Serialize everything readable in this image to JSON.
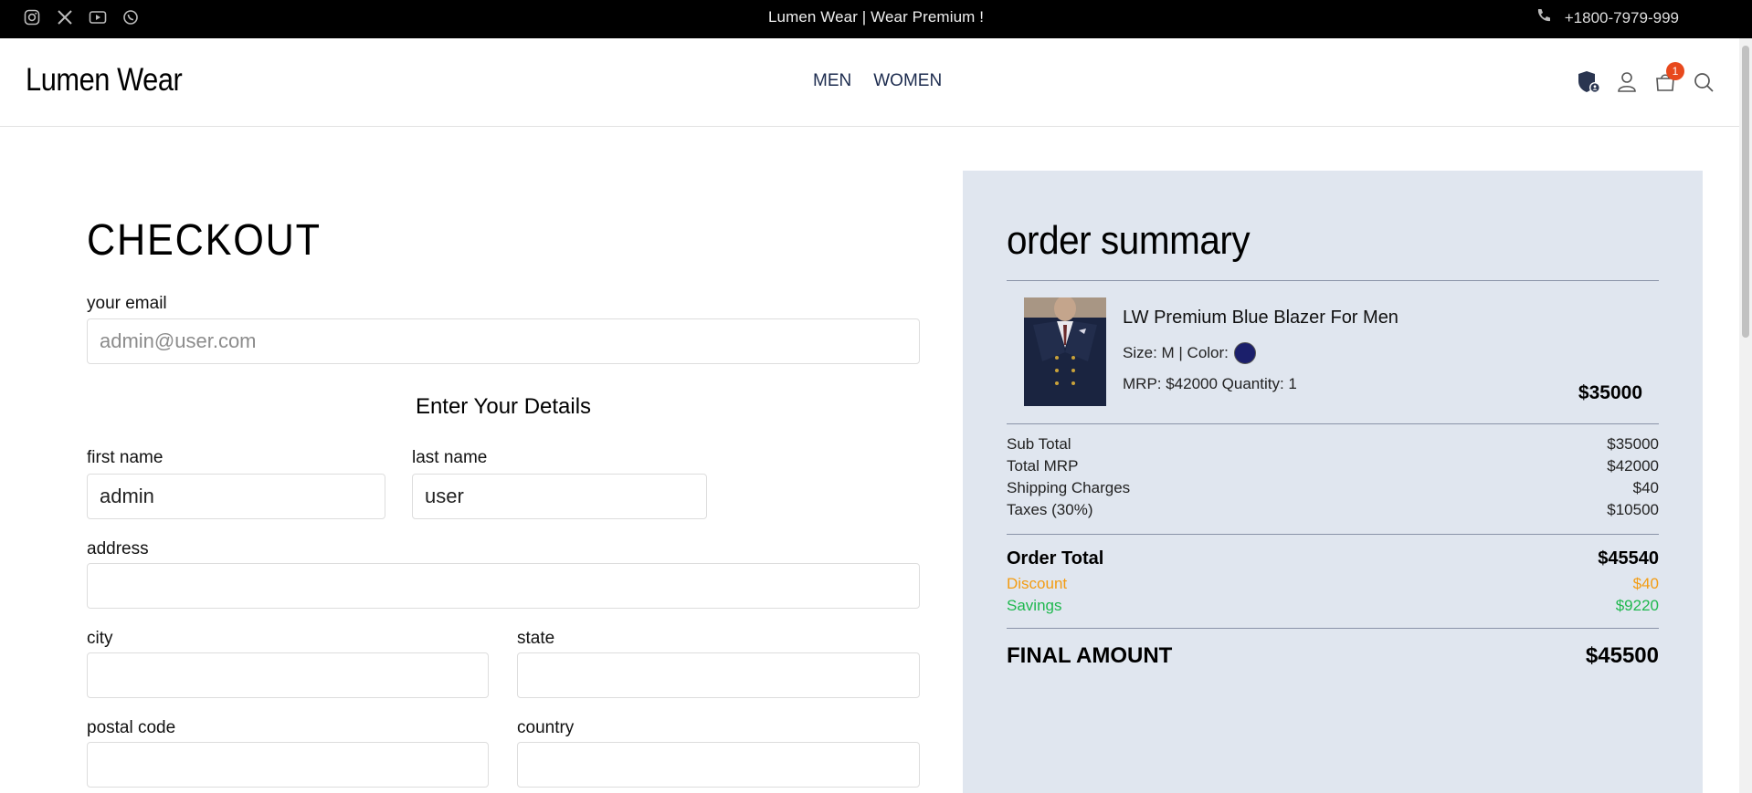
{
  "topbar": {
    "social_icons": [
      "instagram-icon",
      "x-icon",
      "youtube-icon",
      "whatsapp-icon"
    ],
    "promo": "Lumen Wear  |   Wear Premium !",
    "phone": "+1800-7979-999"
  },
  "header": {
    "brand": "Lumen Wear",
    "nav": [
      "MEN",
      "WOMEN"
    ],
    "cart_count": "1"
  },
  "checkout": {
    "title": "CHECKOUT",
    "email_label": "your email",
    "email_placeholder": "admin@user.com",
    "details_heading": "Enter Your Details",
    "first_name_label": "first name",
    "first_name_value": "admin",
    "last_name_label": "last name",
    "last_name_value": "user",
    "address_label": "address",
    "city_label": "city",
    "state_label": "state",
    "postal_label": "postal code",
    "country_label": "country"
  },
  "summary": {
    "title": "order summary",
    "product": {
      "name": "LW Premium Blue Blazer For Men",
      "size_color": "Size: M | Color:",
      "color_hex": "#1b1f6b",
      "mrp_qty": "MRP: $42000  Quantity: 1",
      "price": "$35000"
    },
    "rows": {
      "subtotal_label": "Sub Total",
      "subtotal_value": "$35000",
      "mrp_label": "Total MRP",
      "mrp_value": "$42000",
      "shipping_label": "Shipping Charges",
      "shipping_value": "$40",
      "taxes_label": "Taxes (30%)",
      "taxes_value": "$10500",
      "order_total_label": "Order Total",
      "order_total_value": "$45540",
      "discount_label": "Discount",
      "discount_value": "$40",
      "savings_label": "Savings",
      "savings_value": "$9220",
      "final_label": "FINAL AMOUNT",
      "final_value": "$45500"
    }
  },
  "colors": {
    "summary_bg": "#e0e6ef",
    "discount": "#f39c12",
    "savings": "#1fb84e",
    "badge": "#e8491d"
  }
}
